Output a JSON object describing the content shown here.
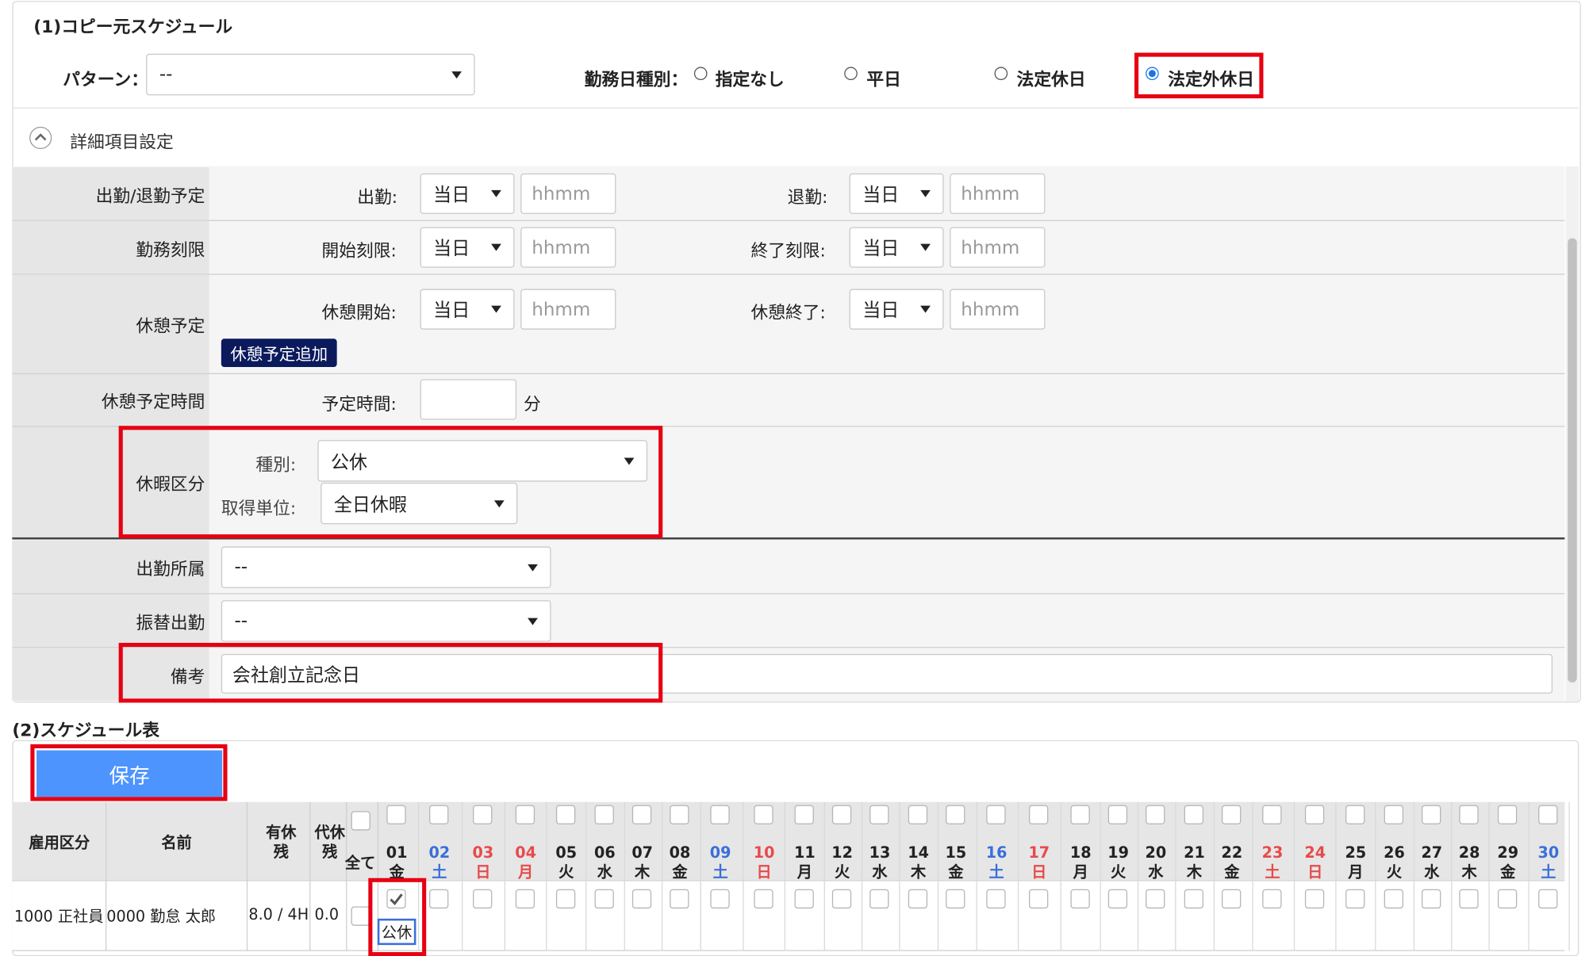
{
  "section1": {
    "title": "(1)コピー元スケジュール",
    "pattern_label": "パターン：",
    "pattern_value": "--",
    "daytype_label": "勤務日種別：",
    "daytype_options": [
      "指定なし",
      "平日",
      "法定休日",
      "法定外休日"
    ],
    "daytype_selected": "法定外休日",
    "details_toggle": "詳細項目設定"
  },
  "details": {
    "attendance_row": "出勤/退勤予定",
    "checkin_label": "出勤:",
    "checkout_label": "退勤:",
    "limit_row": "勤務刻限",
    "start_limit_label": "開始刻限:",
    "end_limit_label": "終了刻限:",
    "break_row": "休憩予定",
    "break_start_label": "休憩開始:",
    "break_end_label": "休憩終了:",
    "add_break_button": "休憩予定追加",
    "break_time_row": "休憩予定時間",
    "planned_time_label": "予定時間:",
    "minutes_unit": "分",
    "leave_row": "休暇区分",
    "leave_type_label": "種別:",
    "leave_type_value": "公休",
    "leave_unit_label": "取得単位:",
    "leave_unit_value": "全日休暇",
    "dept_row": "出勤所属",
    "dept_value": "--",
    "transfer_row": "振替出勤",
    "transfer_value": "--",
    "remarks_row": "備考",
    "remarks_value": "会社創立記念日",
    "day_value": "当日",
    "time_placeholder": "hhmm"
  },
  "section2": {
    "title": "(2)スケジュール表",
    "save_button": "保存",
    "headers": {
      "employment": "雇用区分",
      "name": "名前",
      "paid_leave": "有休残",
      "comp_leave": "代休残",
      "all": "全て"
    },
    "days": [
      {
        "d": "01",
        "w": "金",
        "t": "day"
      },
      {
        "d": "02",
        "w": "土",
        "t": "sat"
      },
      {
        "d": "03",
        "w": "日",
        "t": "sun"
      },
      {
        "d": "04",
        "w": "月",
        "t": "sun"
      },
      {
        "d": "05",
        "w": "火",
        "t": "day"
      },
      {
        "d": "06",
        "w": "水",
        "t": "day"
      },
      {
        "d": "07",
        "w": "木",
        "t": "day"
      },
      {
        "d": "08",
        "w": "金",
        "t": "day"
      },
      {
        "d": "09",
        "w": "土",
        "t": "sat"
      },
      {
        "d": "10",
        "w": "日",
        "t": "sun"
      },
      {
        "d": "11",
        "w": "月",
        "t": "day"
      },
      {
        "d": "12",
        "w": "火",
        "t": "day"
      },
      {
        "d": "13",
        "w": "水",
        "t": "day"
      },
      {
        "d": "14",
        "w": "木",
        "t": "day"
      },
      {
        "d": "15",
        "w": "金",
        "t": "day"
      },
      {
        "d": "16",
        "w": "土",
        "t": "sat"
      },
      {
        "d": "17",
        "w": "日",
        "t": "sun"
      },
      {
        "d": "18",
        "w": "月",
        "t": "day"
      },
      {
        "d": "19",
        "w": "火",
        "t": "day"
      },
      {
        "d": "20",
        "w": "水",
        "t": "day"
      },
      {
        "d": "21",
        "w": "木",
        "t": "day"
      },
      {
        "d": "22",
        "w": "金",
        "t": "day"
      },
      {
        "d": "23",
        "w": "土",
        "t": "sun"
      },
      {
        "d": "24",
        "w": "日",
        "t": "sun"
      },
      {
        "d": "25",
        "w": "月",
        "t": "day"
      },
      {
        "d": "26",
        "w": "火",
        "t": "day"
      },
      {
        "d": "27",
        "w": "水",
        "t": "day"
      },
      {
        "d": "28",
        "w": "木",
        "t": "day"
      },
      {
        "d": "29",
        "w": "金",
        "t": "day"
      },
      {
        "d": "30",
        "w": "土",
        "t": "sat"
      }
    ],
    "row": {
      "employment": "1000 正社員",
      "name": "0000 勤怠 太郎",
      "paid_leave": "8.0 / 4H",
      "comp_leave": "0.0",
      "day01_tag": "公休"
    }
  },
  "colors": {
    "accent_blue": "#4d94ff",
    "highlight_red": "#e60012",
    "saturday": "#3a6fd8",
    "sunday": "#e84a4a",
    "navy_button": "#0b1a5c"
  }
}
